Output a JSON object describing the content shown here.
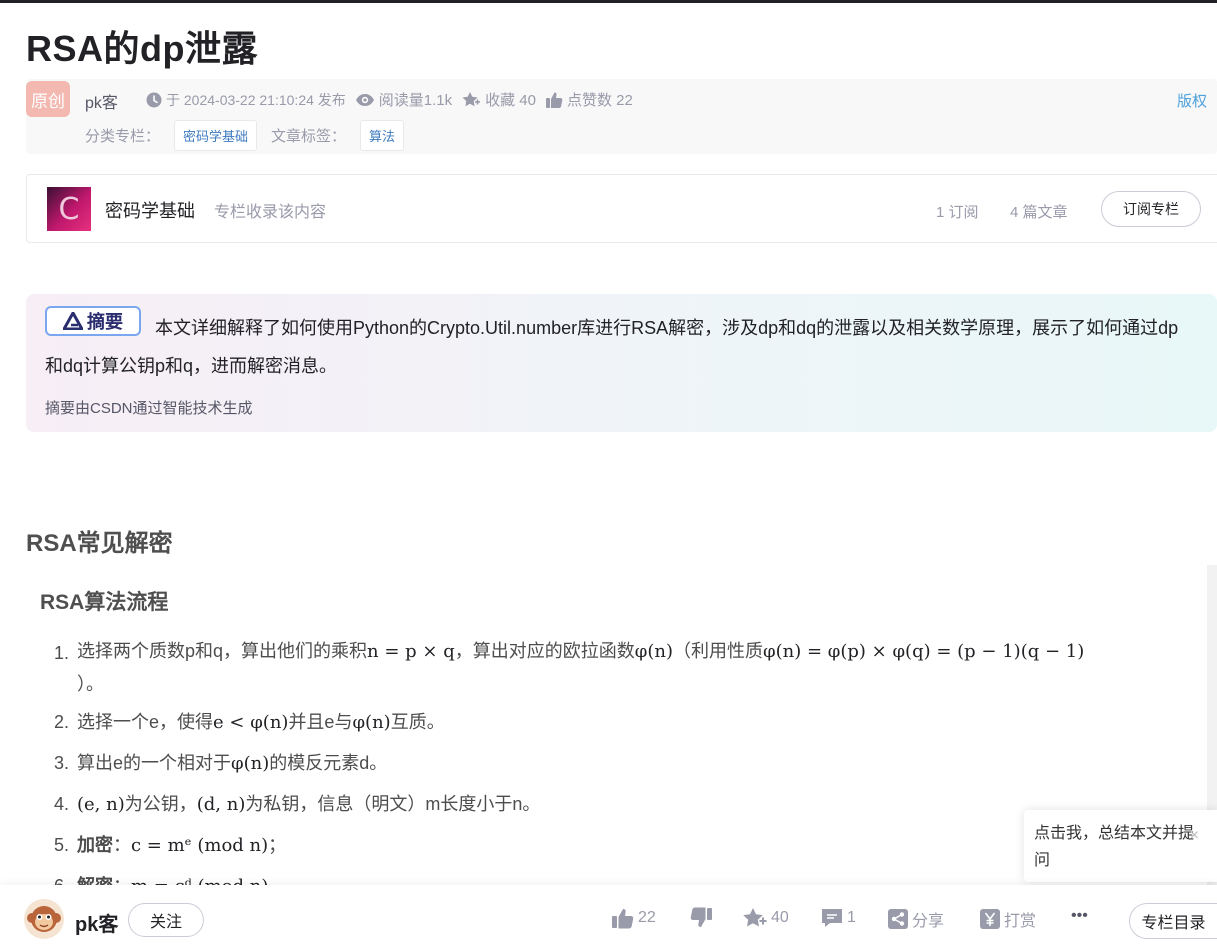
{
  "article": {
    "title": "RSA的dp泄露"
  },
  "meta": {
    "original_badge": "原创",
    "author": "pk客",
    "publish_time": "于 2024-03-22 21:10:24 发布",
    "read_count": "阅读量1.1k",
    "favorites": "收藏 40",
    "likes": "点赞数 22",
    "copyright": "版权",
    "category_label": "分类专栏：",
    "category_tag": "密码学基础",
    "tag_label": "文章标签：",
    "article_tag": "算法"
  },
  "column": {
    "thumb_letter": "C",
    "name": "密码学基础",
    "subtitle": "专栏收录该内容",
    "subscribers": "1 订阅",
    "articles": "4 篇文章",
    "subscribe_button": "订阅专栏"
  },
  "abstract": {
    "badge": "摘要",
    "text": "本文详细解释了如何使用Python的Crypto.Util.number库进行RSA解密，涉及dp和dq的泄露以及相关数学原理，展示了如何通过dp和dq计算公钥p和q，进而解密消息。",
    "footer": "摘要由CSDN通过智能技术生成"
  },
  "content": {
    "h2": "RSA常见解密",
    "h3": "RSA算法流程",
    "steps": [
      {
        "num": "1.",
        "a": "选择两个质数p和q，算出他们的乘积",
        "m1": "n = p × q",
        "b": "，算出对应的欧拉函数",
        "m2": "φ(n)",
        "c": "（利用性质",
        "m3": "φ(n) = φ(p) × φ(q) = (p − 1)(q − 1)",
        "d": "）。"
      },
      {
        "num": "2.",
        "a": "选择一个e，使得",
        "m1": "e < φ(n)",
        "b": "并且e与",
        "m2": "φ(n)",
        "c": "互质。"
      },
      {
        "num": "3.",
        "a": "算出e的一个相对于",
        "m1": "φ(n)",
        "b": "的模反元素d。"
      },
      {
        "num": "4.",
        "m1": "(e, n)",
        "a": "为公钥，",
        "m2": "(d, n)",
        "b": "为私钥，信息（明文）m长度小于n。"
      },
      {
        "num": "5.",
        "bold": "加密",
        "a": "：",
        "m1": "c = mᵉ (mod n)",
        "b": "；"
      },
      {
        "num": "6.",
        "bold": "解密",
        "a": "：",
        "m1": "m = cᵈ (mod n)"
      }
    ]
  },
  "popup": {
    "text": "点击我，总结本文并提问",
    "close": "×"
  },
  "bottom": {
    "author": "pk客",
    "follow": "关注",
    "likes": "22",
    "favorites": "40",
    "comments": "1",
    "share": "分享",
    "reward": "打赏",
    "more": "•••",
    "catalog": "专栏目录"
  },
  "colors": {
    "accent_link": "#4ea1db",
    "tag_text": "#3d7bbf",
    "original_badge": "#f3b8b0",
    "muted": "#999aaa"
  }
}
